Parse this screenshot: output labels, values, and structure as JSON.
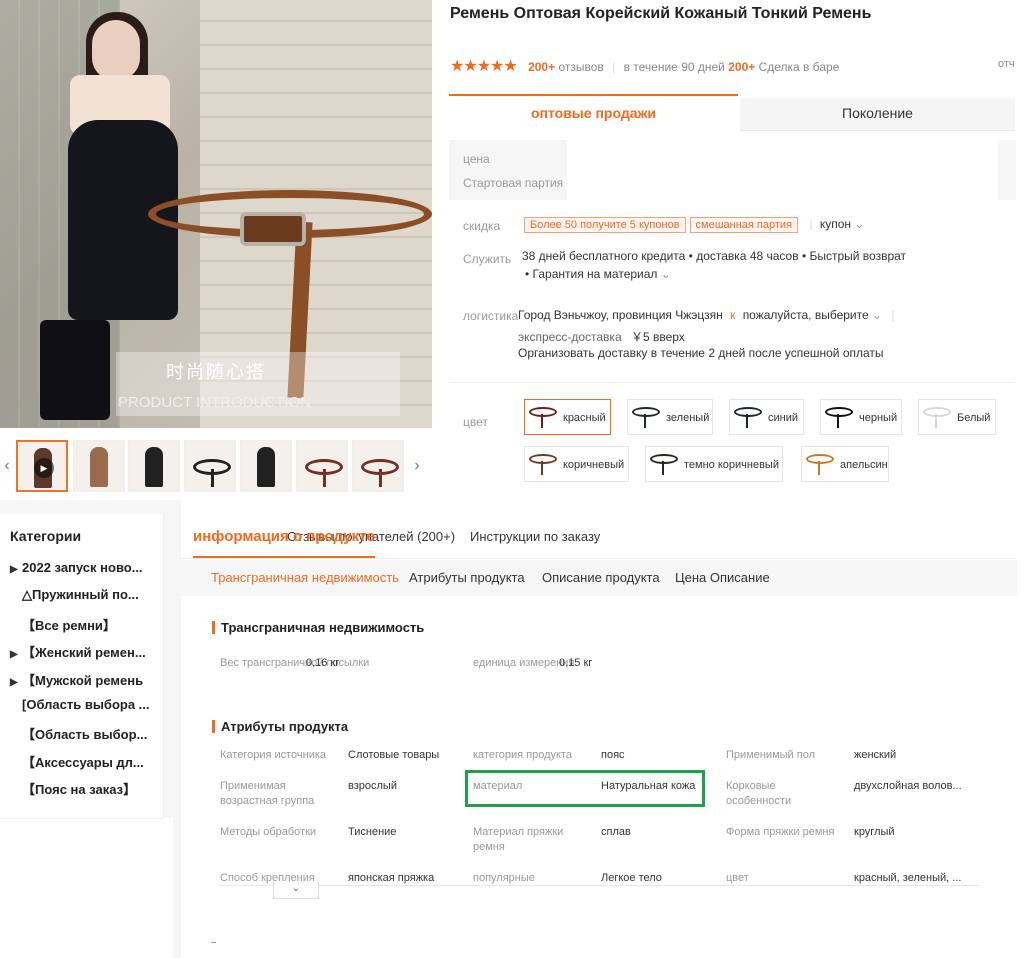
{
  "product": {
    "title": "Ремень Оптовая Корейский Кожаный Тонкий Ремень",
    "stars": "★★★★★",
    "reviews_count": "200+",
    "reviews_label": "отзывов",
    "period_label": "в течение 90 дней",
    "deals_count": "200+",
    "deals_label": "Сделка в баре",
    "cut_text": "отч"
  },
  "image": {
    "caption_cn": "时尚随心搭",
    "caption_en": "PRODUCT  INTRODUCTION",
    "prev_arrow": "‹",
    "next_arrow": "›",
    "play_icon": "▶"
  },
  "tabs": {
    "wholesale": "оптовые продажи",
    "generation": "Поколение"
  },
  "price": {
    "price_label": "цена",
    "start_batch_label": "Стартовая партия"
  },
  "discount": {
    "label": "скидка",
    "tag1": "Более 50 получите 5 купонов",
    "tag2": "смешанная партия",
    "coupon": "купон",
    "coupon_icon": "chevron-down"
  },
  "service": {
    "label": "Служить",
    "line1": "38 дней бесплатного кредита • доставка 48 часов • Быстрый возврат",
    "line2": "• Гарантия на материал"
  },
  "logistics": {
    "label": "логистика",
    "origin": "Город Вэньчжоу, провинция Чжэцзян",
    "to": "к",
    "destination": "пожалуйста, выберите",
    "express": "экспресс-доставка",
    "express_price": "￥5 вверх",
    "note": "Организовать доставку в течение 2 дней после успешной оплаты"
  },
  "colors": {
    "label": "цвет",
    "options": [
      {
        "label": "красный",
        "color": "#6b1f1a",
        "selected": true
      },
      {
        "label": "зеленый",
        "color": "#1f2a24"
      },
      {
        "label": "синий",
        "color": "#1c2436"
      },
      {
        "label": "черный",
        "color": "#111111"
      },
      {
        "label": "Белый",
        "color": "#d8d8d8"
      },
      {
        "label": "коричневый",
        "color": "#6e3a22"
      },
      {
        "label": "темно коричневый",
        "color": "#2b2320"
      },
      {
        "label": "апельсин",
        "color": "#c77a2a"
      }
    ]
  },
  "sidebar": {
    "title": "Категории",
    "items": [
      {
        "label": "2022 запуск ново...",
        "arrow": "▶"
      },
      {
        "label": "△Пружинный по...",
        "arrow": ""
      },
      {
        "label": "【Все ремни】",
        "arrow": ""
      },
      {
        "label": "【Женский ремен...",
        "arrow": "▶"
      },
      {
        "label": "【Мужской ремень",
        "arrow": "▶"
      },
      {
        "label": "[Область выбора ...",
        "arrow": ""
      },
      {
        "label": "【Область выбор...",
        "arrow": ""
      },
      {
        "label": "【Аксессуары дл...",
        "arrow": ""
      },
      {
        "label": "【Пояс на заказ】",
        "arrow": ""
      }
    ]
  },
  "detail_tabs": {
    "info": "информация о продукте",
    "reviews": "Отзывы покупателей (200+)",
    "instructions": "Инструкции по заказу"
  },
  "subnav": {
    "items": [
      "Трансграничная недвижимость",
      "Атрибуты продукта",
      "Описание продукта",
      "Цена Описание"
    ]
  },
  "cross_border": {
    "title": "Трансграничная недвижимость",
    "weight_label": "Вес трансграничной посылки",
    "weight_value": "0,16 кг",
    "unit_label": "единица измерения",
    "unit_value": "0,15 кг"
  },
  "attributes": {
    "title": "Атрибуты продукта",
    "rows": [
      [
        {
          "label": "Категория источника",
          "value": "Слотовые товары"
        },
        {
          "label": "категория продукта",
          "value": "пояс"
        },
        {
          "label": "Применимый пол",
          "value": "женский"
        }
      ],
      [
        {
          "label": "Применимая возрастная группа",
          "value": "взрослый"
        },
        {
          "label": "материал",
          "value": "Натуральная кожа"
        },
        {
          "label": "Корковые особенности",
          "value": "двухслойная волов..."
        }
      ],
      [
        {
          "label": "Методы обработки",
          "value": "Тиснение"
        },
        {
          "label": "Материал пряжки ремня",
          "value": "сплав"
        },
        {
          "label": "Форма пряжки ремня",
          "value": "круглый"
        }
      ],
      [
        {
          "label": "Способ крепления",
          "value": "японская пряжка"
        },
        {
          "label": "популярные",
          "value": "Легкое тело"
        },
        {
          "label": "цвет",
          "value": "красный, зеленый, ..."
        }
      ]
    ],
    "expand_icon": "⌄"
  },
  "accent_color": "#f06b1e",
  "highlight_color": "#1fa14a"
}
